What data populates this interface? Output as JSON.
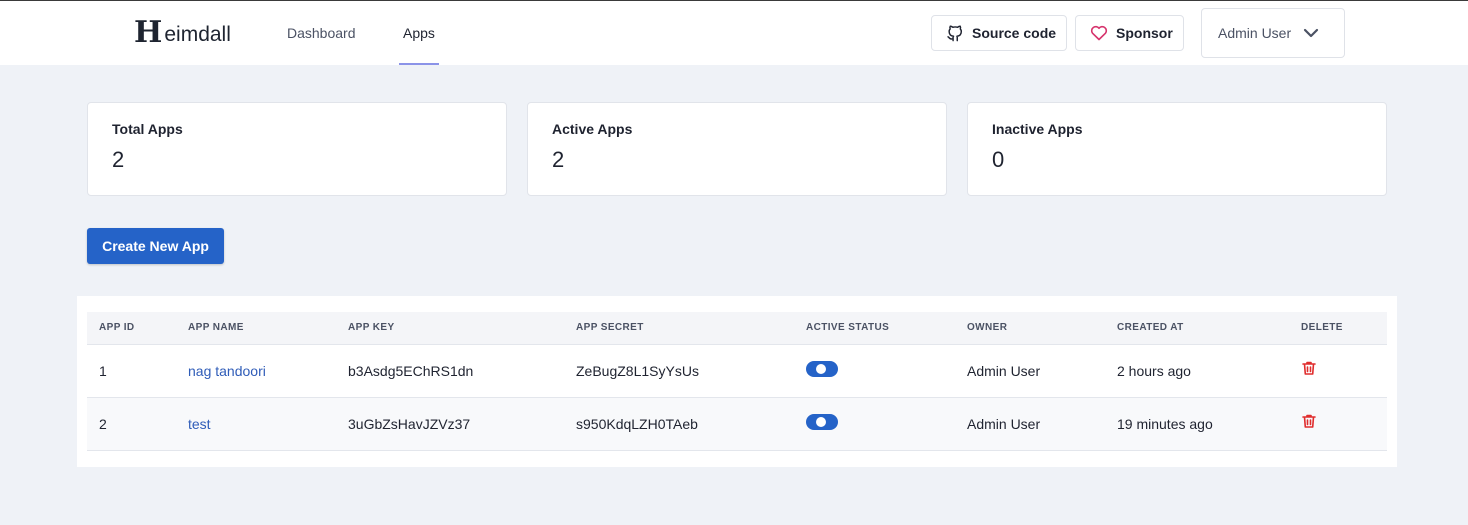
{
  "header": {
    "logo_letter": "H",
    "logo_text": "eimdall",
    "nav": [
      {
        "label": "Dashboard",
        "active": false
      },
      {
        "label": "Apps",
        "active": true
      }
    ],
    "source_code_label": "Source code",
    "sponsor_label": "Sponsor",
    "user_name": "Admin User"
  },
  "stats": [
    {
      "label": "Total Apps",
      "value": "2"
    },
    {
      "label": "Active Apps",
      "value": "2"
    },
    {
      "label": "Inactive Apps",
      "value": "0"
    }
  ],
  "create_button_label": "Create New App",
  "table": {
    "columns": [
      "APP ID",
      "APP NAME",
      "APP KEY",
      "APP SECRET",
      "ACTIVE STATUS",
      "OWNER",
      "CREATED AT",
      "DELETE"
    ],
    "rows": [
      {
        "id": "1",
        "name": "nag tandoori",
        "key": "b3Asdg5EChRS1dn",
        "secret": "ZeBugZ8L1SyYsUs",
        "active": true,
        "owner": "Admin User",
        "created": "2 hours ago"
      },
      {
        "id": "2",
        "name": "test",
        "key": "3uGbZsHavJZVz37",
        "secret": "s950KdqLZH0TAeb",
        "active": true,
        "owner": "Admin User",
        "created": "19 minutes ago"
      }
    ]
  },
  "colors": {
    "accent": "#2563c8",
    "nav_underline": "#8b93e8",
    "delete": "#e02d2d",
    "sponsor_heart": "#d6336c",
    "background": "#eff2f7"
  },
  "icons": {
    "source_code": "github-icon",
    "sponsor": "heart-icon",
    "user_menu": "chevron-down-icon",
    "delete": "trash-icon"
  }
}
